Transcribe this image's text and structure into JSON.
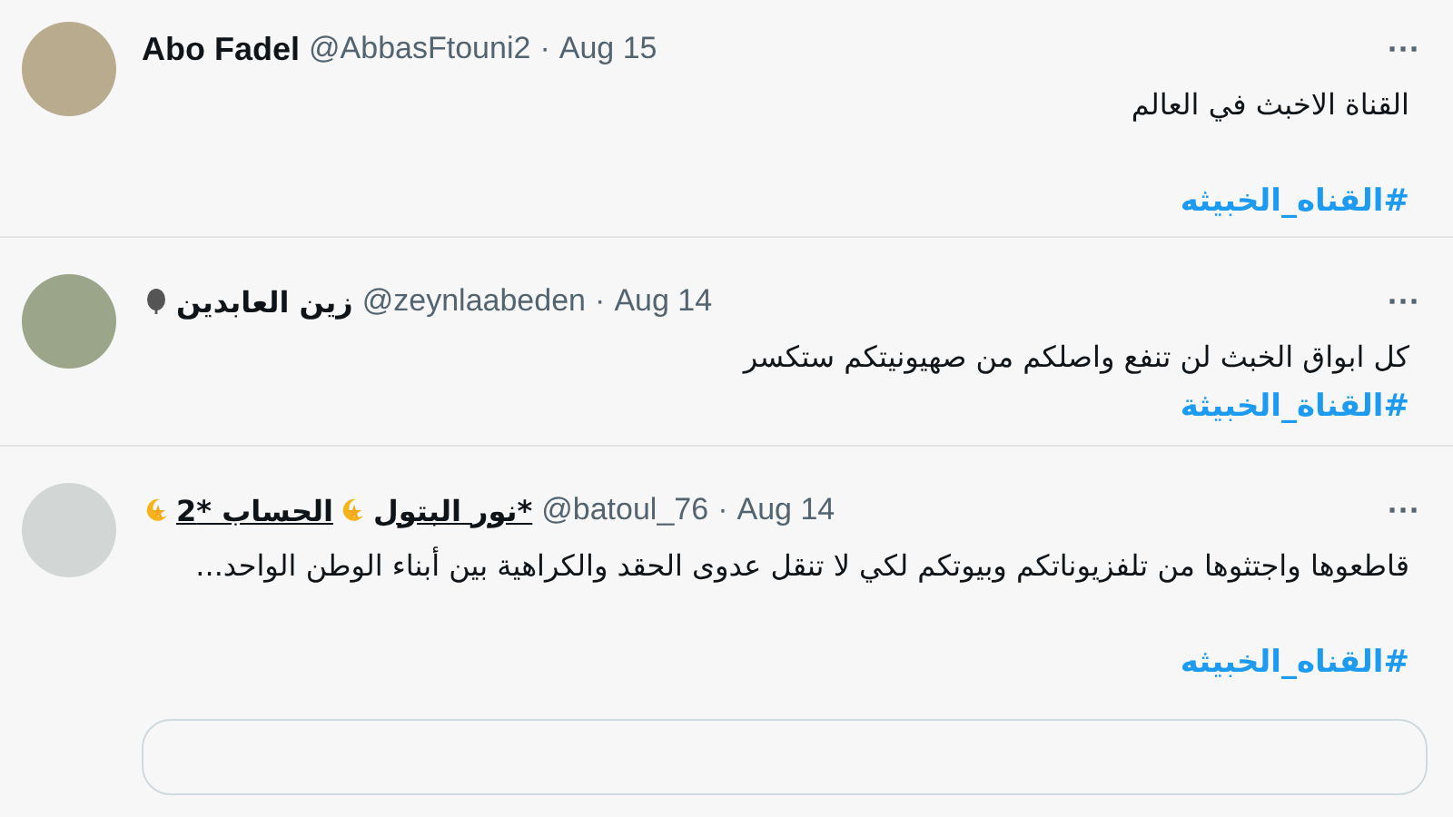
{
  "tweets": [
    {
      "name_parts": [
        {
          "kind": "text",
          "text": "Abo Fadel"
        }
      ],
      "name_underlined": false,
      "handle": "@AbbasFtouni2",
      "separator": "·",
      "date": "Aug 15",
      "more": "···",
      "text": "القناة الاخبث في العالم",
      "hashtag": "#القناه_الخبيثه"
    },
    {
      "name_parts": [
        {
          "kind": "text",
          "text": "زين العابدين"
        },
        {
          "kind": "pin"
        }
      ],
      "name_underlined": false,
      "handle": "@zeynlaabeden",
      "separator": "·",
      "date": "Aug 14",
      "more": "···",
      "text": "كل ابواق الخبث لن تنفع واصلكم من صهيونيتكم ستكسر",
      "hashtag": "#القناة_الخبيثة"
    },
    {
      "name_parts": [
        {
          "kind": "text",
          "text": "*نور البتول"
        },
        {
          "kind": "star"
        },
        {
          "kind": "text",
          "text": "الحساب *2"
        },
        {
          "kind": "star"
        }
      ],
      "name_underlined": true,
      "handle": "@batoul_76",
      "separator": "·",
      "date": "Aug 14",
      "more": "···",
      "text": "قاطعوها واجتثوها من تلفزيوناتكم وبيوتكم لكي لا تنقل عدوى الحقد والكراهية بين أبناء الوطن الواحد...",
      "hashtag": "#القناه_الخبيثه",
      "card": {
        "kind": "link_preview"
      }
    }
  ]
}
